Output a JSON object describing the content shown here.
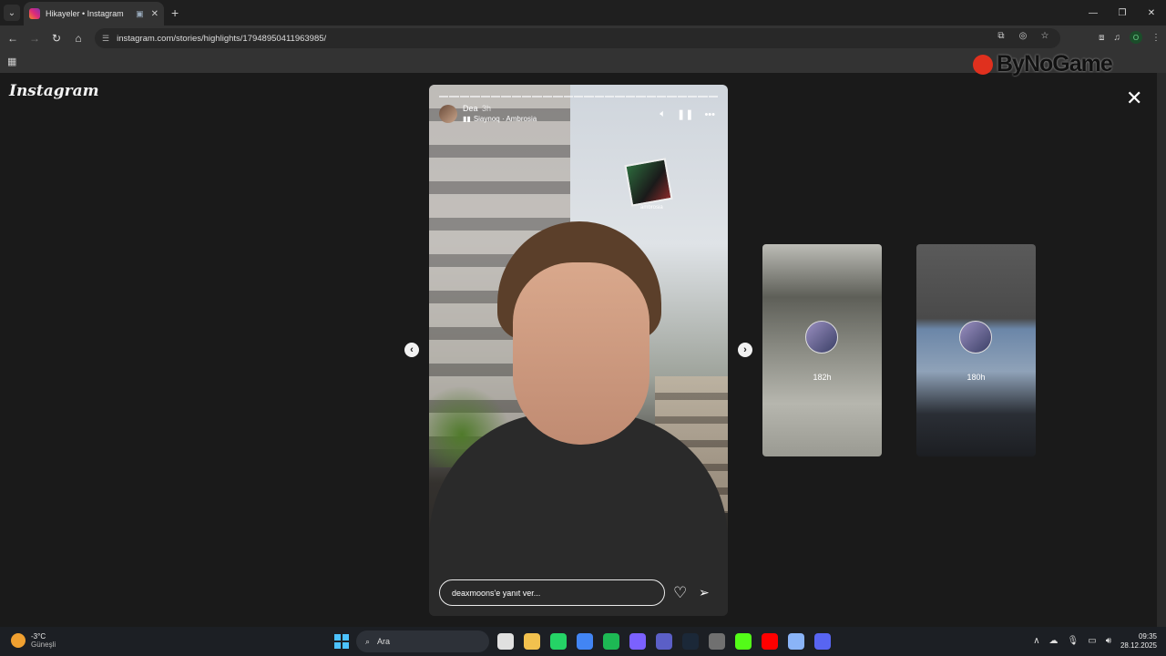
{
  "browser": {
    "tab_title": "Hikayeler • Instagram",
    "url": "instagram.com/stories/highlights/17948950411963985/",
    "profile_initial": "O"
  },
  "page": {
    "logo": "Instagram",
    "watermark": "ByNoGame"
  },
  "story": {
    "username": "Dea",
    "time": "3h",
    "music": "Siaynoq · Ambrosia",
    "sticker_caption": "ambrosia",
    "reply_placeholder": "deaxmoons'e yanıt ver...",
    "progress_segments": 27
  },
  "next_stories": [
    {
      "time": "182h"
    },
    {
      "time": "180h"
    }
  ],
  "taskbar": {
    "temperature": "-3°C",
    "weather": "Güneşli",
    "search_placeholder": "Ara",
    "time": "09:35",
    "date": "28.12.2025",
    "app_colors": [
      "#e0e0e0",
      "#f2c14e",
      "#25d366",
      "#4285f4",
      "#1db954",
      "#7b61ff",
      "#5b5fc7",
      "#1b2838",
      "#707070",
      "#53fc18",
      "#ff0000",
      "#8ab4f8",
      "#5865f2"
    ]
  }
}
